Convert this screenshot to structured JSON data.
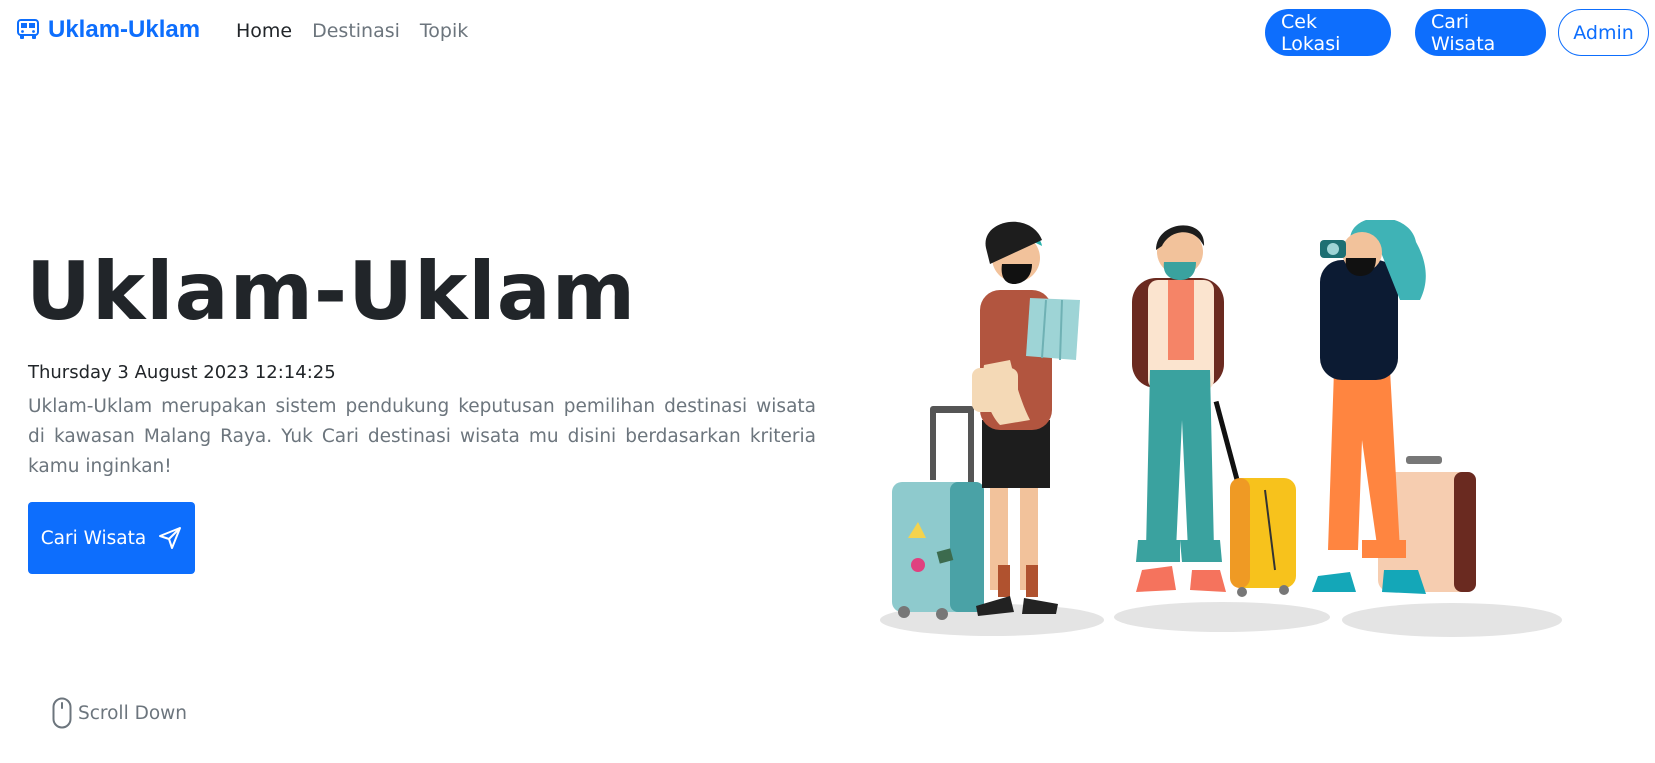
{
  "brand": {
    "name": "Uklam-Uklam",
    "icon": "bus-icon",
    "color": "#0d6efd"
  },
  "nav": {
    "links": [
      {
        "label": "Home",
        "active": true
      },
      {
        "label": "Destinasi",
        "active": false
      },
      {
        "label": "Topik",
        "active": false
      }
    ],
    "buttons": {
      "cek_lokasi": "Cek Lokasi",
      "cari_wisata": "Cari Wisata",
      "admin": "Admin"
    }
  },
  "hero": {
    "title": "Uklam-Uklam",
    "datetime": "Thursday 3 August 2023 12:14:25",
    "description": "Uklam-Uklam merupakan sistem pendukung keputusan pemilihan destinasi wisata di kawasan Malang Raya. Yuk Cari destinasi wisata mu disini berdasarkan kriteria kamu inginkan!",
    "cta_label": "Cari Wisata",
    "cta_icon": "send-icon"
  },
  "scroll": {
    "label": "Scroll Down",
    "icon": "mouse-icon"
  },
  "colors": {
    "primary": "#0d6efd",
    "muted": "#6c757d",
    "text": "#212529"
  }
}
